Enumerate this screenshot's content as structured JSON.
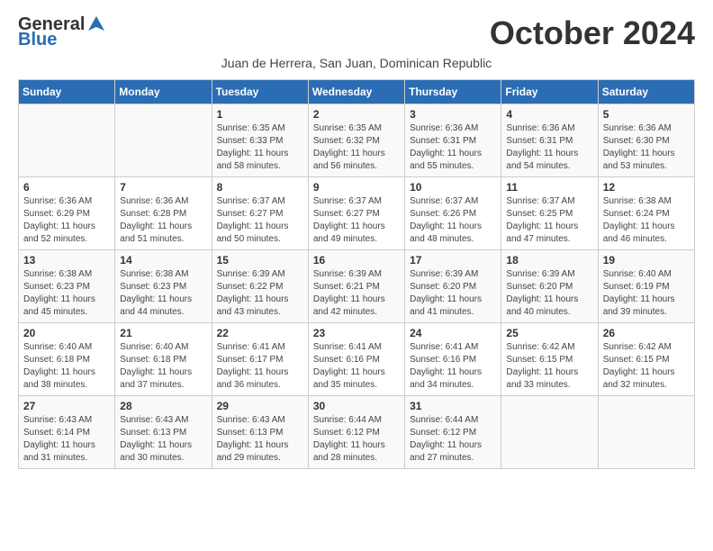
{
  "logo": {
    "general": "General",
    "blue": "Blue"
  },
  "title": "October 2024",
  "subtitle": "Juan de Herrera, San Juan, Dominican Republic",
  "days_of_week": [
    "Sunday",
    "Monday",
    "Tuesday",
    "Wednesday",
    "Thursday",
    "Friday",
    "Saturday"
  ],
  "weeks": [
    [
      {
        "day": "",
        "info": ""
      },
      {
        "day": "",
        "info": ""
      },
      {
        "day": "1",
        "info": "Sunrise: 6:35 AM\nSunset: 6:33 PM\nDaylight: 11 hours and 58 minutes."
      },
      {
        "day": "2",
        "info": "Sunrise: 6:35 AM\nSunset: 6:32 PM\nDaylight: 11 hours and 56 minutes."
      },
      {
        "day": "3",
        "info": "Sunrise: 6:36 AM\nSunset: 6:31 PM\nDaylight: 11 hours and 55 minutes."
      },
      {
        "day": "4",
        "info": "Sunrise: 6:36 AM\nSunset: 6:31 PM\nDaylight: 11 hours and 54 minutes."
      },
      {
        "day": "5",
        "info": "Sunrise: 6:36 AM\nSunset: 6:30 PM\nDaylight: 11 hours and 53 minutes."
      }
    ],
    [
      {
        "day": "6",
        "info": "Sunrise: 6:36 AM\nSunset: 6:29 PM\nDaylight: 11 hours and 52 minutes."
      },
      {
        "day": "7",
        "info": "Sunrise: 6:36 AM\nSunset: 6:28 PM\nDaylight: 11 hours and 51 minutes."
      },
      {
        "day": "8",
        "info": "Sunrise: 6:37 AM\nSunset: 6:27 PM\nDaylight: 11 hours and 50 minutes."
      },
      {
        "day": "9",
        "info": "Sunrise: 6:37 AM\nSunset: 6:27 PM\nDaylight: 11 hours and 49 minutes."
      },
      {
        "day": "10",
        "info": "Sunrise: 6:37 AM\nSunset: 6:26 PM\nDaylight: 11 hours and 48 minutes."
      },
      {
        "day": "11",
        "info": "Sunrise: 6:37 AM\nSunset: 6:25 PM\nDaylight: 11 hours and 47 minutes."
      },
      {
        "day": "12",
        "info": "Sunrise: 6:38 AM\nSunset: 6:24 PM\nDaylight: 11 hours and 46 minutes."
      }
    ],
    [
      {
        "day": "13",
        "info": "Sunrise: 6:38 AM\nSunset: 6:23 PM\nDaylight: 11 hours and 45 minutes."
      },
      {
        "day": "14",
        "info": "Sunrise: 6:38 AM\nSunset: 6:23 PM\nDaylight: 11 hours and 44 minutes."
      },
      {
        "day": "15",
        "info": "Sunrise: 6:39 AM\nSunset: 6:22 PM\nDaylight: 11 hours and 43 minutes."
      },
      {
        "day": "16",
        "info": "Sunrise: 6:39 AM\nSunset: 6:21 PM\nDaylight: 11 hours and 42 minutes."
      },
      {
        "day": "17",
        "info": "Sunrise: 6:39 AM\nSunset: 6:20 PM\nDaylight: 11 hours and 41 minutes."
      },
      {
        "day": "18",
        "info": "Sunrise: 6:39 AM\nSunset: 6:20 PM\nDaylight: 11 hours and 40 minutes."
      },
      {
        "day": "19",
        "info": "Sunrise: 6:40 AM\nSunset: 6:19 PM\nDaylight: 11 hours and 39 minutes."
      }
    ],
    [
      {
        "day": "20",
        "info": "Sunrise: 6:40 AM\nSunset: 6:18 PM\nDaylight: 11 hours and 38 minutes."
      },
      {
        "day": "21",
        "info": "Sunrise: 6:40 AM\nSunset: 6:18 PM\nDaylight: 11 hours and 37 minutes."
      },
      {
        "day": "22",
        "info": "Sunrise: 6:41 AM\nSunset: 6:17 PM\nDaylight: 11 hours and 36 minutes."
      },
      {
        "day": "23",
        "info": "Sunrise: 6:41 AM\nSunset: 6:16 PM\nDaylight: 11 hours and 35 minutes."
      },
      {
        "day": "24",
        "info": "Sunrise: 6:41 AM\nSunset: 6:16 PM\nDaylight: 11 hours and 34 minutes."
      },
      {
        "day": "25",
        "info": "Sunrise: 6:42 AM\nSunset: 6:15 PM\nDaylight: 11 hours and 33 minutes."
      },
      {
        "day": "26",
        "info": "Sunrise: 6:42 AM\nSunset: 6:15 PM\nDaylight: 11 hours and 32 minutes."
      }
    ],
    [
      {
        "day": "27",
        "info": "Sunrise: 6:43 AM\nSunset: 6:14 PM\nDaylight: 11 hours and 31 minutes."
      },
      {
        "day": "28",
        "info": "Sunrise: 6:43 AM\nSunset: 6:13 PM\nDaylight: 11 hours and 30 minutes."
      },
      {
        "day": "29",
        "info": "Sunrise: 6:43 AM\nSunset: 6:13 PM\nDaylight: 11 hours and 29 minutes."
      },
      {
        "day": "30",
        "info": "Sunrise: 6:44 AM\nSunset: 6:12 PM\nDaylight: 11 hours and 28 minutes."
      },
      {
        "day": "31",
        "info": "Sunrise: 6:44 AM\nSunset: 6:12 PM\nDaylight: 11 hours and 27 minutes."
      },
      {
        "day": "",
        "info": ""
      },
      {
        "day": "",
        "info": ""
      }
    ]
  ]
}
